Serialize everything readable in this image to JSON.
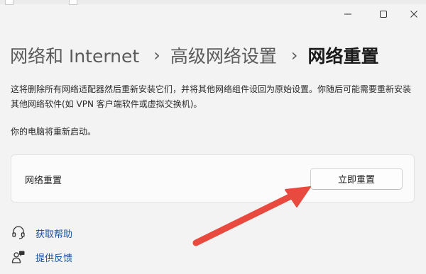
{
  "window": {
    "controls": [
      "minimize-icon",
      "maximize-icon",
      "close-icon"
    ]
  },
  "breadcrumb": {
    "items": [
      "网络和 Internet",
      "高级网络设置",
      "网络重置"
    ],
    "separator": "›"
  },
  "description": "这将删除所有网络适配器然后重新安装它们，并将其他网络组件设回为原始设置。你随后可能需要重新安装其他网络软件(如 VPN 客户端软件或虚拟交换机)。",
  "restart_note": "你的电脑将重新启动。",
  "reset_card": {
    "label": "网络重置",
    "button_label": "立即重置"
  },
  "links": [
    {
      "label": "获取帮助",
      "icon": "help-icon"
    },
    {
      "label": "提供反馈",
      "icon": "feedback-icon"
    }
  ],
  "colors": {
    "background": "#f3f3f3",
    "card": "#fbfbfb",
    "link": "#1a4fa0",
    "annotation_arrow": "#e94a3f"
  }
}
